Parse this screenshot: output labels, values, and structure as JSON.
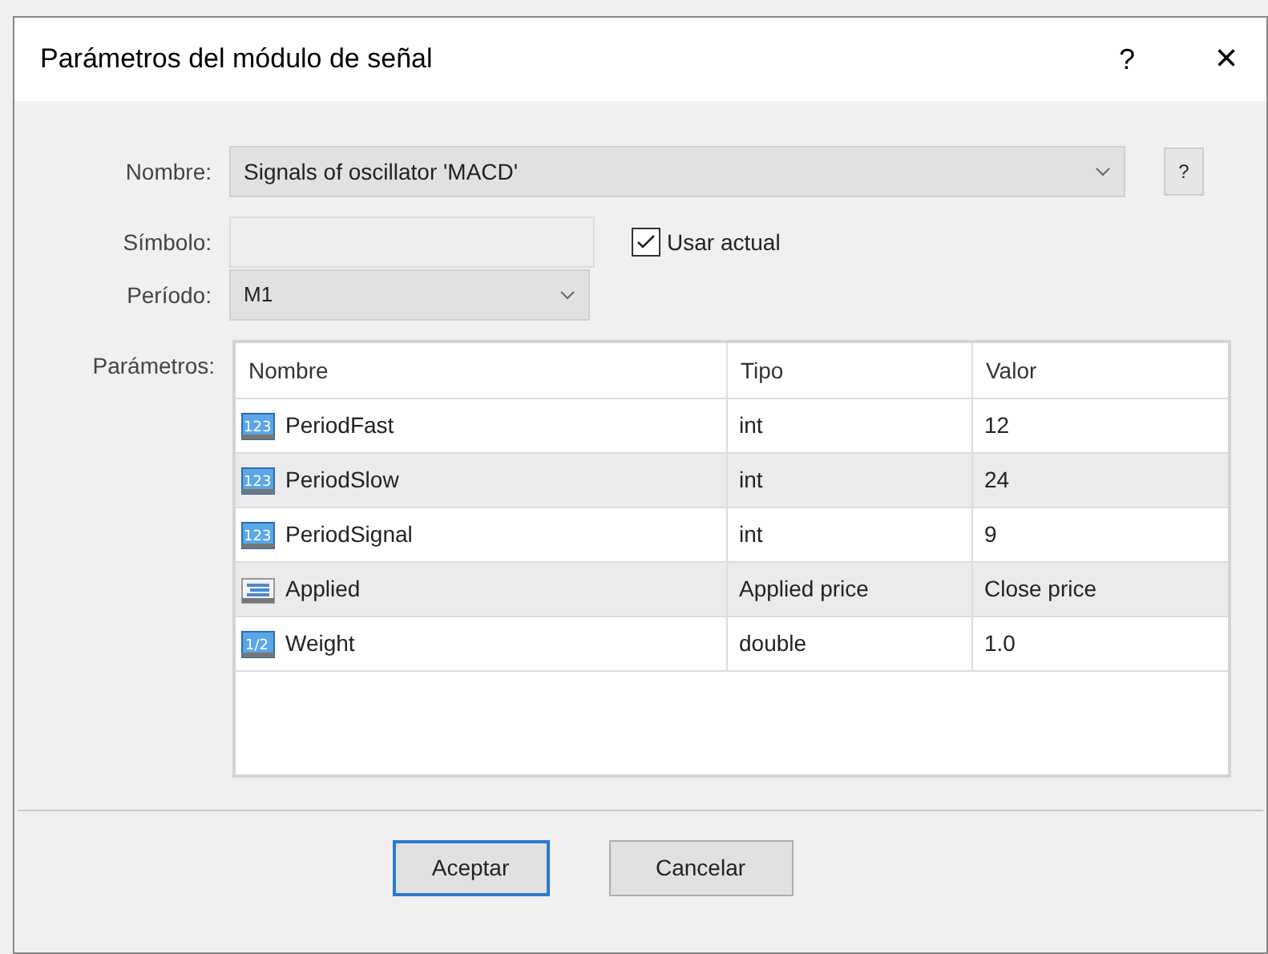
{
  "window": {
    "title": "Parámetros del módulo de señal",
    "help": "?",
    "close": "×"
  },
  "nombre": {
    "label": "Nombre:",
    "value": "Signals of oscillator 'MACD'",
    "help": "?"
  },
  "simbolo": {
    "label": "Símbolo:",
    "checkbox": {
      "label": "Usar actual",
      "checked": true
    }
  },
  "periodo": {
    "label": "Período:",
    "value": "M1"
  },
  "parametros": {
    "label": "Parámetros:",
    "columns": [
      "Nombre",
      "Tipo",
      "Valor"
    ],
    "rows": [
      {
        "kind": "integer",
        "icon_label": "123",
        "name": "PeriodFast",
        "type": "int",
        "value": "12"
      },
      {
        "kind": "integer",
        "icon_label": "123",
        "name": "PeriodSlow",
        "type": "int",
        "value": "24"
      },
      {
        "kind": "integer",
        "icon_label": "123",
        "name": "PeriodSignal",
        "type": "int",
        "value": "9"
      },
      {
        "kind": "enum",
        "name": "Applied",
        "type": "Applied price",
        "value": "Close price"
      },
      {
        "kind": "fraction",
        "icon_label": "1/2",
        "name": "Weight",
        "type": "double",
        "value": "1.0"
      }
    ]
  },
  "buttons": [
    {
      "label": "Aceptar",
      "default": true
    },
    {
      "label": "Cancelar",
      "default": false
    }
  ]
}
